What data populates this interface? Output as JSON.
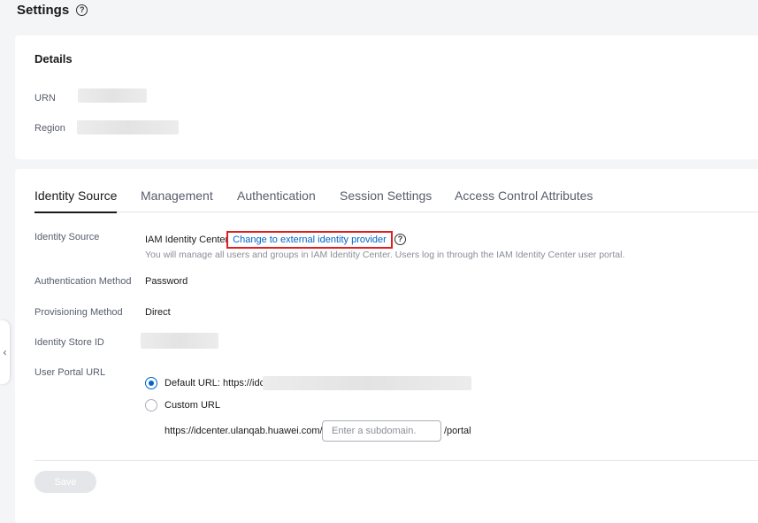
{
  "header": {
    "title": "Settings",
    "help_glyph": "?"
  },
  "details": {
    "title": "Details",
    "urn_label": "URN",
    "region_label": "Region"
  },
  "tabs": [
    {
      "label": "Identity Source",
      "active": true
    },
    {
      "label": "Management",
      "active": false
    },
    {
      "label": "Authentication",
      "active": false
    },
    {
      "label": "Session Settings",
      "active": false
    },
    {
      "label": "Access Control Attributes",
      "active": false
    }
  ],
  "form": {
    "identity_source": {
      "label": "Identity Source",
      "value": "IAM Identity Center",
      "link": "Change to external identity provider",
      "hint": "You will manage all users and groups in IAM Identity Center. Users log in through the IAM Identity Center user portal."
    },
    "auth_method": {
      "label": "Authentication Method",
      "value": "Password"
    },
    "provisioning": {
      "label": "Provisioning Method",
      "value": "Direct"
    },
    "store_id": {
      "label": "Identity Store ID"
    },
    "portal_url": {
      "label": "User Portal URL",
      "default_option": "Default URL: https://idc",
      "custom_option": "Custom URL",
      "custom_prefix": "https://idcenter.ulanqab.huawei.com/",
      "subdomain_placeholder": "Enter a subdomain.",
      "custom_suffix": "/portal",
      "selected": "default"
    }
  },
  "actions": {
    "save_label": "Save"
  },
  "sidebar_toggle": {
    "glyph": "‹"
  },
  "colors": {
    "link": "#0064c8",
    "highlight": "#e02020",
    "radio": "#0064c8"
  }
}
